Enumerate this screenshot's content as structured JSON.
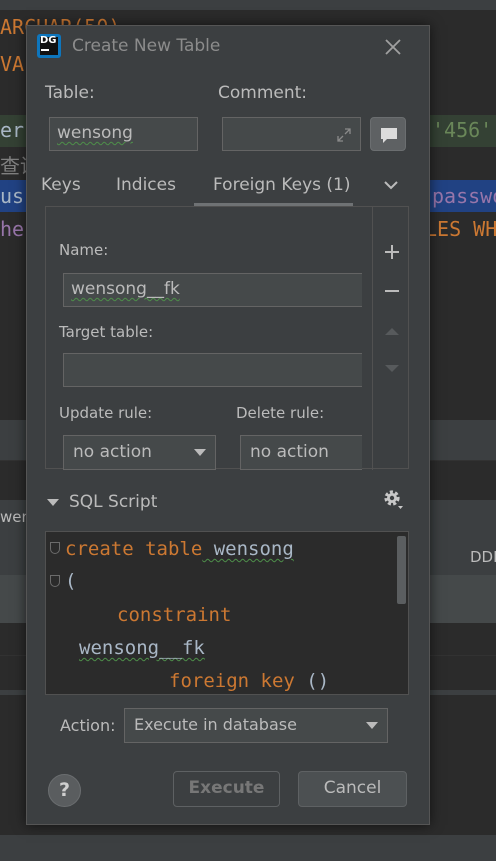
{
  "dialog": {
    "title": "Create New Table",
    "logo_text": "DG",
    "close_icon": "close-icon"
  },
  "table": {
    "label": "Table:",
    "value": "wensong",
    "comment_label": "Comment:",
    "comment_value": ""
  },
  "tabs": [
    {
      "label": "Keys"
    },
    {
      "label": "Indices"
    },
    {
      "label": "Foreign Keys (1)",
      "selected": true
    }
  ],
  "foreign_key": {
    "name_label": "Name:",
    "name_value": "wensong__fk",
    "target_label": "Target table:",
    "target_value": "",
    "update_label": "Update rule:",
    "update_value": "no action",
    "delete_label": "Delete rule:",
    "delete_value": "no action"
  },
  "sql": {
    "header": "SQL Script",
    "lines": [
      {
        "kw": "create table",
        "id": " wensong"
      },
      {
        "id": "("
      },
      {
        "kw": "constraint"
      },
      {
        "id": "wensong__fk"
      },
      {
        "kw": "foreign key",
        "id": " ()"
      }
    ]
  },
  "action": {
    "label": "Action:",
    "value": "Execute in database"
  },
  "buttons": {
    "help": "?",
    "execute": "Execute",
    "cancel": "Cancel"
  },
  "background": {
    "line1": "ARCHAR(50),",
    "line2": "VA",
    "line3": "er",
    "line3b": "'456'",
    "line4": "查询",
    "line5": "us",
    "line5b": "passwo",
    "line6": "he",
    "line6b": "LES WH",
    "tab_fragment": "wen",
    "right_fragment": "DDL"
  },
  "colors": {
    "accent_keyword": "#cc7832",
    "identifier": "#a9b7c6",
    "dialog_bg": "#3c3f41",
    "editor_bg": "#2b2b2b"
  }
}
